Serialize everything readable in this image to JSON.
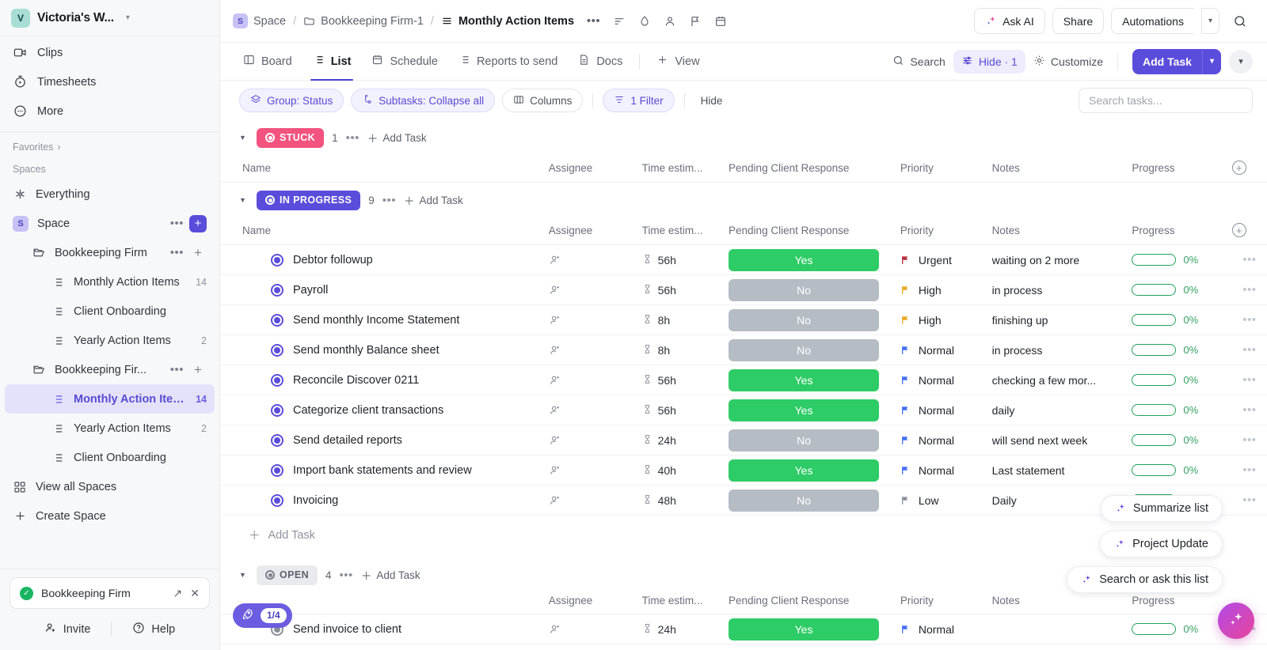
{
  "workspace": {
    "initial": "V",
    "name": "Victoria's W...",
    "caret": "chevron-down"
  },
  "sidebar": {
    "top_nav": [
      {
        "label": "Clips",
        "icon": "clip-video-icon"
      },
      {
        "label": "Timesheets",
        "icon": "timesheet-icon"
      },
      {
        "label": "More",
        "icon": "more-icon"
      }
    ],
    "favorites_label": "Favorites",
    "spaces_label": "Spaces",
    "everything_label": "Everything",
    "space": {
      "initial": "S",
      "label": "Space"
    },
    "folders": [
      {
        "label": "Bookkeeping Firm"
      },
      {
        "label": "Bookkeeping Fir..."
      }
    ],
    "lists_a": [
      {
        "label": "Monthly Action Items",
        "count": "14"
      },
      {
        "label": "Client Onboarding",
        "count": ""
      },
      {
        "label": "Yearly Action Items",
        "count": "2"
      }
    ],
    "lists_b": [
      {
        "label": "Monthly Action Items",
        "count": "14",
        "active": true
      },
      {
        "label": "Yearly Action Items",
        "count": "2"
      },
      {
        "label": "Client Onboarding",
        "count": ""
      }
    ],
    "view_all_spaces": "View all Spaces",
    "create_space": "Create Space",
    "toast": {
      "label": "Bookkeeping Firm"
    },
    "invite": "Invite",
    "help": "Help"
  },
  "topbar": {
    "breadcrumb": [
      {
        "label": "Space",
        "icon": "space-badge"
      },
      {
        "label": "Bookkeeping Firm-1",
        "icon": "folder-icon"
      },
      {
        "label": "Monthly Action Items",
        "icon": "list-icon"
      }
    ],
    "ask_ai": "Ask AI",
    "share": "Share",
    "automations": "Automations"
  },
  "viewbar": {
    "tabs": [
      {
        "label": "Board",
        "icon": "board-icon",
        "active": false
      },
      {
        "label": "List",
        "icon": "list-icon",
        "active": true
      },
      {
        "label": "Schedule",
        "icon": "calendar-icon",
        "active": false
      },
      {
        "label": "Reports to send",
        "icon": "list-icon",
        "active": false
      },
      {
        "label": "Docs",
        "icon": "doc-icon",
        "active": false
      }
    ],
    "add_view": "View",
    "search": "Search",
    "hide": "Hide · 1",
    "customize": "Customize",
    "add_task": "Add Task"
  },
  "filterbar": {
    "group": "Group: Status",
    "subtasks": "Subtasks: Collapse all",
    "columns": "Columns",
    "filter": "1 Filter",
    "hide": "Hide",
    "search_placeholder": "Search tasks..."
  },
  "columns": [
    "Name",
    "Assignee",
    "Time estim...",
    "Pending Client Response",
    "Priority",
    "Notes",
    "Progress"
  ],
  "add_task_row": "Add Task",
  "groups": [
    {
      "status": "STUCK",
      "count": "1",
      "add": "Add Task",
      "tasks": []
    },
    {
      "status": "IN PROGRESS",
      "count": "9",
      "add": "Add Task",
      "tasks": [
        {
          "name": "Debtor followup",
          "time": "56h",
          "pending": "Yes",
          "priority": "Urgent",
          "notes": "waiting on 2 more",
          "progress": "0%"
        },
        {
          "name": "Payroll",
          "time": "56h",
          "pending": "No",
          "priority": "High",
          "notes": "in process",
          "progress": "0%"
        },
        {
          "name": "Send monthly Income Statement",
          "time": "8h",
          "pending": "No",
          "priority": "High",
          "notes": "finishing up",
          "progress": "0%"
        },
        {
          "name": "Send monthly Balance sheet",
          "time": "8h",
          "pending": "No",
          "priority": "Normal",
          "notes": "in process",
          "progress": "0%"
        },
        {
          "name": "Reconcile Discover 0211",
          "time": "56h",
          "pending": "Yes",
          "priority": "Normal",
          "notes": "checking a few mor...",
          "progress": "0%"
        },
        {
          "name": "Categorize client transactions",
          "time": "56h",
          "pending": "Yes",
          "priority": "Normal",
          "notes": "daily",
          "progress": "0%"
        },
        {
          "name": "Send detailed reports",
          "time": "24h",
          "pending": "No",
          "priority": "Normal",
          "notes": "will send next week",
          "progress": "0%"
        },
        {
          "name": "Import bank statements and review",
          "time": "40h",
          "pending": "Yes",
          "priority": "Normal",
          "notes": "Last statement",
          "progress": "0%"
        },
        {
          "name": "Invoicing",
          "time": "48h",
          "pending": "No",
          "priority": "Low",
          "notes": "Daily",
          "progress": "0%"
        }
      ]
    },
    {
      "status": "OPEN",
      "count": "4",
      "add": "Add Task",
      "tasks": [
        {
          "name": "Send invoice to client",
          "time": "24h",
          "pending": "Yes",
          "priority": "Normal",
          "notes": "",
          "progress": "0%"
        }
      ]
    }
  ],
  "floating": {
    "summarize": "Summarize list",
    "project_update": "Project Update",
    "search_ask": "Search or ask this list",
    "rocket_count": "1/4"
  },
  "colors": {
    "accent": "#5b4ddb",
    "stuck": "#f3537f",
    "yes": "#2ecc66",
    "no": "#b6bcc4",
    "urgent": "#b8293a",
    "high": "#eaa822",
    "normal": "#3f6bf5",
    "low": "#8a8f99",
    "progress": "#21a05a"
  }
}
